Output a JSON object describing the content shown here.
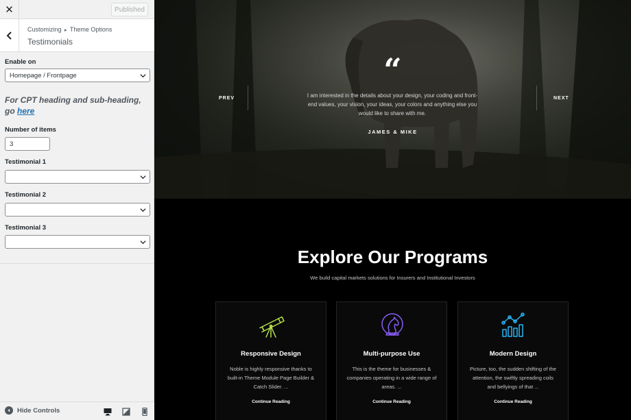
{
  "topbar": {
    "close_glyph": "✕",
    "publish_label": "Published"
  },
  "section": {
    "breadcrumb_parent": "Customizing",
    "breadcrumb_sep": "▸",
    "breadcrumb_current": "Theme Options",
    "title": "Testimonials"
  },
  "controls": {
    "enable_on": {
      "label": "Enable on",
      "value": "Homepage / Frontpage"
    },
    "note_text": "For CPT heading and sub-heading, go ",
    "note_link": "here",
    "num_items": {
      "label": "Number of items",
      "value": "3"
    },
    "testimonials": [
      {
        "label": "Testimonial 1",
        "value": ""
      },
      {
        "label": "Testimonial 2",
        "value": ""
      },
      {
        "label": "Testimonial 3",
        "value": ""
      }
    ]
  },
  "footer": {
    "hide_label": "Hide Controls"
  },
  "hero": {
    "quote_mark": "“",
    "quote": "I am interested in the details about your design, your coding and front-end values, your vision, your ideas, your colors and anything else you would like to share with me.",
    "author": "JAMES & MIKE",
    "prev": "PREV",
    "next": "NEXT"
  },
  "programs": {
    "title": "Explore Our Programs",
    "subtitle": "We build capital markets solutions for Insurers and Institutional Investors",
    "cards": [
      {
        "icon": "telescope-icon",
        "title": "Responsive Design",
        "text": "Noble is highly responsive thanks to built-in Theme Module Page Builder & Catch Slider. ...",
        "link": "Continue Reading"
      },
      {
        "icon": "chess-knight-icon",
        "title": "Multi-purpose Use",
        "text": "This is the theme for businesses & companies operating in a wide range of areas. ...",
        "link": "Continue Reading"
      },
      {
        "icon": "analytics-chart-icon",
        "title": "Modern Design",
        "text": "Picture, too, the sudden shifting of the attention, the swiftly spreading coils and bellyings of that ...",
        "link": "Continue Reading"
      }
    ]
  },
  "colors": {
    "panel_bg": "#f1f1f1",
    "link": "#2271b1",
    "telescope": "#b6e24a",
    "knight": "#8a5cf6",
    "analytics": "#29b6f6"
  }
}
